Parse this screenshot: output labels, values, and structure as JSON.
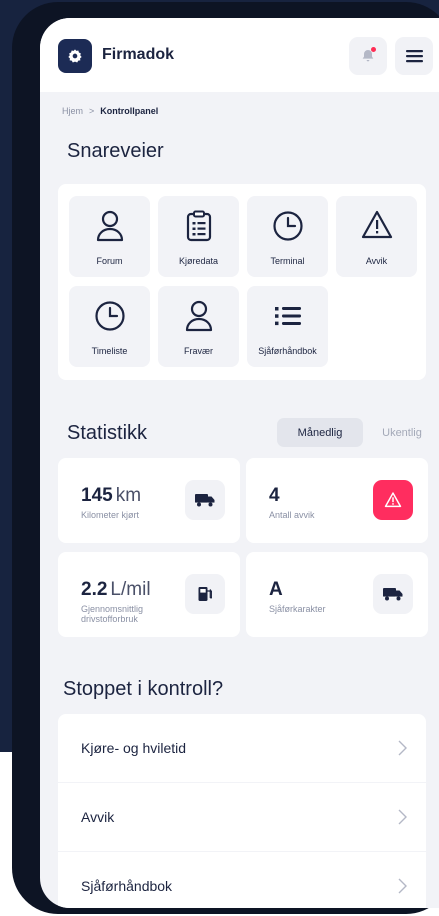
{
  "header": {
    "app_name": "Firmadok",
    "logo_icon": "settings-gear-icon",
    "notification_icon": "bell-icon",
    "menu_icon": "hamburger-menu-icon",
    "colors": {
      "brand": "#1c2b55",
      "accent": "#ff2d55"
    }
  },
  "breadcrumb": {
    "home": "Hjem",
    "separator": ">",
    "current": "Kontrollpanel"
  },
  "shortcuts": {
    "title": "Snareveier",
    "items": [
      {
        "label": "Forum",
        "icon": "person-icon"
      },
      {
        "label": "Kjøredata",
        "icon": "clipboard-list-icon"
      },
      {
        "label": "Terminal",
        "icon": "clock-icon"
      },
      {
        "label": "Avvik",
        "icon": "warning-triangle-icon"
      },
      {
        "label": "Timeliste",
        "icon": "clock-icon"
      },
      {
        "label": "Fravær",
        "icon": "person-icon"
      },
      {
        "label": "Sjåførhåndbok",
        "icon": "list-icon"
      }
    ]
  },
  "statistics": {
    "title": "Statistikk",
    "toggle": {
      "monthly": "Månedlig",
      "weekly": "Ukentlig",
      "selected": "monthly"
    },
    "cards": [
      {
        "value": "145",
        "unit": "km",
        "label": "Kilometer kjørt",
        "icon": "truck-icon"
      },
      {
        "value": "4",
        "unit": "",
        "label": "Antall avvik",
        "icon": "warning-triangle-icon"
      },
      {
        "value": "2.2",
        "unit": "L/mil",
        "label": "Gjennomsnittlig drivstofforbruk",
        "icon": "fuel-pump-icon"
      },
      {
        "value": "A",
        "unit": "",
        "label": "Sjåførkarakter",
        "icon": "truck-icon"
      }
    ]
  },
  "control_stop": {
    "title": "Stoppet i kontroll?",
    "items": [
      {
        "label": "Kjøre- og hviletid"
      },
      {
        "label": "Avvik"
      },
      {
        "label": "Sjåførhåndbok"
      }
    ],
    "chevron_icon": "chevron-right-icon"
  }
}
